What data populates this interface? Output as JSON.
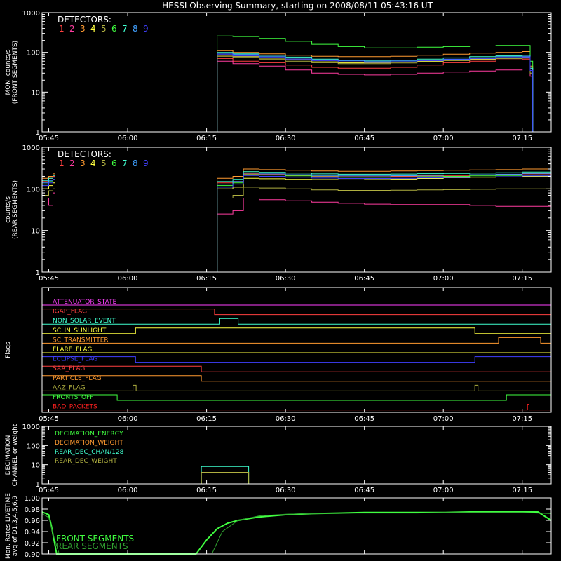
{
  "title": "HESSI Observing Summary, starting on 2008/08/11 05:43:16 UT",
  "time_ticks": [
    "05:45",
    "06:00",
    "06:15",
    "06:30",
    "06:45",
    "07:00",
    "07:15"
  ],
  "chart_data": [
    {
      "type": "line",
      "panel": "front-counts",
      "ylabel": [
        "MON. counts/s",
        "(FRONT SEGMENTS)"
      ],
      "yscale": "log",
      "ylim": [
        1,
        1000
      ],
      "ytick_labels": [
        "1",
        "10",
        "100",
        "1000"
      ],
      "xlim_min": [
        -1.27,
        95.5
      ],
      "detectors_label": "DETECTORS:",
      "detector_numbers": [
        "1",
        "2",
        "3",
        "4",
        "5",
        "6",
        "7",
        "8",
        "9"
      ],
      "detector_colors": [
        "#ff4040",
        "#ff3ca0",
        "#ff9a30",
        "#ffff40",
        "#b0b040",
        "#40ff40",
        "#40ffd0",
        "#40a0ff",
        "#4040ff"
      ],
      "x": [
        31.5,
        32,
        35,
        40,
        45,
        50,
        55,
        60,
        65,
        70,
        75,
        80,
        85,
        90,
        91.5,
        92
      ],
      "series": [
        {
          "values": [
            1,
            70,
            60,
            55,
            48,
            42,
            40,
            40,
            42,
            48,
            55,
            60,
            65,
            68,
            40,
            1
          ]
        },
        {
          "values": [
            1,
            60,
            52,
            45,
            36,
            30,
            28,
            27,
            28,
            30,
            32,
            34,
            36,
            38,
            25,
            1
          ]
        },
        {
          "values": [
            1,
            110,
            100,
            92,
            85,
            80,
            78,
            78,
            80,
            85,
            90,
            96,
            100,
            105,
            45,
            1
          ]
        },
        {
          "values": [
            1,
            85,
            80,
            72,
            65,
            58,
            55,
            55,
            57,
            60,
            64,
            68,
            72,
            75,
            35,
            1
          ]
        },
        {
          "values": [
            1,
            80,
            75,
            68,
            60,
            55,
            52,
            52,
            54,
            58,
            62,
            66,
            70,
            72,
            30,
            1
          ]
        },
        {
          "values": [
            1,
            260,
            250,
            225,
            190,
            160,
            140,
            130,
            130,
            135,
            140,
            145,
            150,
            150,
            60,
            1
          ]
        },
        {
          "values": [
            1,
            100,
            92,
            85,
            76,
            68,
            64,
            63,
            64,
            68,
            73,
            78,
            82,
            85,
            40,
            1
          ]
        },
        {
          "values": [
            1,
            95,
            88,
            80,
            72,
            65,
            62,
            60,
            61,
            64,
            68,
            73,
            78,
            80,
            38,
            1
          ]
        },
        {
          "values": [
            1,
            90,
            82,
            75,
            68,
            62,
            58,
            56,
            58,
            62,
            66,
            70,
            74,
            76,
            35,
            1
          ]
        }
      ]
    },
    {
      "type": "line",
      "panel": "rear-counts",
      "ylabel": [
        "counts/s",
        "(REAR SEGMENTS)"
      ],
      "yscale": "log",
      "ylim": [
        1,
        1000
      ],
      "ytick_labels": [
        "1",
        "10",
        "100",
        "1000"
      ],
      "detectors_label": "DETECTORS:",
      "detector_numbers": [
        "1",
        "2",
        "3",
        "4",
        "5",
        "6",
        "7",
        "8",
        "9"
      ],
      "detector_colors": [
        "#ff4040",
        "#ff3ca0",
        "#ff9a30",
        "#ffff40",
        "#b0b040",
        "#40ff40",
        "#40ffd0",
        "#40a0ff",
        "#4040ff"
      ],
      "x": [
        -1.27,
        0,
        0.8,
        1.2,
        1.5,
        31.5,
        32,
        35,
        37,
        40,
        45,
        50,
        55,
        60,
        65,
        70,
        75,
        80,
        85,
        90,
        95.5
      ],
      "series": [
        {
          "values": [
            150,
            180,
            200,
            1,
            1,
            1,
            140,
            150,
            230,
            220,
            210,
            200,
            195,
            195,
            200,
            205,
            210,
            215,
            220,
            230,
            240
          ]
        },
        {
          "values": [
            60,
            40,
            80,
            1,
            1,
            1,
            25,
            30,
            60,
            55,
            52,
            48,
            45,
            43,
            42,
            42,
            42,
            40,
            38,
            38,
            40
          ]
        },
        {
          "values": [
            180,
            200,
            230,
            1,
            1,
            1,
            180,
            200,
            300,
            290,
            280,
            270,
            265,
            265,
            270,
            275,
            280,
            285,
            290,
            300,
            320
          ]
        },
        {
          "values": [
            100,
            120,
            140,
            1,
            1,
            1,
            100,
            110,
            180,
            175,
            170,
            168,
            165,
            168,
            172,
            178,
            185,
            190,
            195,
            200,
            210
          ]
        },
        {
          "values": [
            70,
            90,
            100,
            1,
            1,
            1,
            60,
            70,
            110,
            105,
            100,
            95,
            92,
            92,
            93,
            95,
            96,
            98,
            100,
            100,
            105
          ]
        },
        {
          "values": [
            130,
            150,
            170,
            1,
            1,
            1,
            120,
            140,
            220,
            215,
            205,
            195,
            190,
            190,
            193,
            197,
            200,
            205,
            210,
            215,
            225
          ]
        },
        {
          "values": [
            160,
            180,
            210,
            1,
            1,
            1,
            150,
            170,
            260,
            250,
            240,
            230,
            225,
            225,
            228,
            232,
            236,
            240,
            245,
            255,
            270
          ]
        },
        {
          "values": [
            140,
            160,
            190,
            1,
            1,
            1,
            130,
            150,
            240,
            230,
            220,
            210,
            205,
            205,
            208,
            212,
            216,
            220,
            225,
            235,
            250
          ]
        },
        {
          "values": [
            120,
            140,
            170,
            1,
            1,
            1,
            110,
            130,
            210,
            200,
            190,
            182,
            178,
            178,
            180,
            184,
            188,
            192,
            196,
            205,
            215
          ]
        }
      ]
    },
    {
      "type": "line",
      "panel": "flags",
      "ylabel": [
        "Flags"
      ],
      "flags": [
        {
          "name": "ATTENUATOR_STATE",
          "color": "#ff40ff",
          "steps": [
            [
              -1.27,
              0
            ],
            [
              95.5,
              0
            ]
          ]
        },
        {
          "name": "IGAP_FLAG",
          "color": "#ff4040",
          "steps": [
            [
              -1.27,
              1
            ],
            [
              31.5,
              0
            ],
            [
              95.5,
              0
            ]
          ]
        },
        {
          "name": "NON_SOLAR_EVENT",
          "color": "#40ffd0",
          "steps": [
            [
              -1.27,
              0
            ],
            [
              32.5,
              1
            ],
            [
              36,
              0
            ],
            [
              95.5,
              0
            ]
          ]
        },
        {
          "name": "SC_IN_SUNLIGHT",
          "color": "#ffff40",
          "steps": [
            [
              -1.27,
              0
            ],
            [
              16.5,
              1
            ],
            [
              81,
              0
            ],
            [
              95.5,
              0
            ]
          ]
        },
        {
          "name": "SC_TRANSMITTER",
          "color": "#ff9a30",
          "steps": [
            [
              -1.27,
              0
            ],
            [
              85.5,
              1
            ],
            [
              93.5,
              0
            ],
            [
              95.5,
              0
            ]
          ]
        },
        {
          "name": "FLARE_FLAG",
          "color": "#ffff40",
          "steps": [
            [
              -1.27,
              0
            ],
            [
              95.5,
              0
            ]
          ]
        },
        {
          "name": "ECLIPSE_FLAG",
          "color": "#4040ff",
          "steps": [
            [
              -1.27,
              1
            ],
            [
              16.5,
              0
            ],
            [
              81,
              1
            ],
            [
              95.5,
              1
            ]
          ]
        },
        {
          "name": "SAA_FLAG",
          "color": "#ff4040",
          "steps": [
            [
              -1.27,
              1
            ],
            [
              29,
              0
            ],
            [
              95.5,
              0
            ]
          ]
        },
        {
          "name": "PARTICLE_FLAG",
          "color": "#ff9a30",
          "steps": [
            [
              -1.27,
              1
            ],
            [
              29,
              0
            ],
            [
              95.5,
              0
            ]
          ]
        },
        {
          "name": "AAZ_FLAG",
          "color": "#b0b040",
          "steps": [
            [
              -1.27,
              0
            ],
            [
              16,
              1
            ],
            [
              16.6,
              0
            ],
            [
              81,
              1
            ],
            [
              81.6,
              0
            ],
            [
              95.5,
              0
            ]
          ]
        },
        {
          "name": "FRONTS_OFF",
          "color": "#40ff40",
          "steps": [
            [
              -1.27,
              1
            ],
            [
              13,
              0
            ],
            [
              87,
              1
            ],
            [
              95.5,
              1
            ]
          ]
        },
        {
          "name": "BAD_PACKETS",
          "color": "#ff2020",
          "steps": [
            [
              -1.27,
              0
            ],
            [
              91,
              1
            ],
            [
              91.3,
              0
            ],
            [
              95.5,
              0
            ]
          ]
        }
      ]
    },
    {
      "type": "line",
      "panel": "decimation",
      "ylabel": [
        "DECIMATION",
        "CHANNEL or weight"
      ],
      "yscale": "log",
      "ylim": [
        1,
        1000
      ],
      "ytick_labels": [
        "1",
        "10",
        "100",
        "1000"
      ],
      "series": [
        {
          "name": "DECIMATION_ENERGY",
          "color": "#40ff40",
          "x": [
            -1.27,
            95.5
          ],
          "values": [
            1,
            1
          ]
        },
        {
          "name": "DECIMATION_WEIGHT",
          "color": "#ff9a30",
          "x": [
            -1.27,
            29,
            29,
            38,
            38,
            95.5
          ],
          "values": [
            1,
            1,
            4,
            4,
            1,
            1
          ]
        },
        {
          "name": "REAR_DEC_CHAN/128",
          "color": "#40ffd0",
          "x": [
            -1.27,
            29,
            29,
            38,
            38,
            95.5
          ],
          "values": [
            1,
            1,
            8,
            8,
            1,
            1
          ]
        },
        {
          "name": "REAR_DEC_WEIGHT",
          "color": "#b0b040",
          "x": [
            -1.27,
            29,
            29,
            38,
            38,
            95.5
          ],
          "values": [
            1,
            1,
            4,
            4,
            1,
            1
          ]
        }
      ]
    },
    {
      "type": "line",
      "panel": "livetime",
      "ylabel": [
        "Mon. Rates LIVETIME",
        "avg of D1,3,4,5,6,9"
      ],
      "ylim": [
        0.9,
        1.0
      ],
      "ytick_labels": [
        "0.90",
        "0.92",
        "0.94",
        "0.96",
        "0.98",
        "1.00"
      ],
      "series": [
        {
          "name": "FRONT SEGMENTS",
          "color": "#40ff40",
          "x": [
            -1.27,
            0,
            0.5,
            1.5,
            28,
            30,
            32,
            34,
            36,
            40,
            45,
            50,
            55,
            60,
            65,
            70,
            75,
            80,
            85,
            90,
            93,
            95.5
          ],
          "values": [
            0.975,
            0.97,
            0.95,
            0.9,
            0.9,
            0.925,
            0.945,
            0.955,
            0.96,
            0.966,
            0.97,
            0.972,
            0.973,
            0.974,
            0.974,
            0.974,
            0.974,
            0.975,
            0.975,
            0.975,
            0.975,
            0.96
          ]
        },
        {
          "name": "REAR SEGMENTS",
          "color": "#30a030",
          "x": [
            -1.27,
            0,
            1,
            2,
            31,
            33,
            36,
            40,
            45,
            50,
            55,
            60,
            65,
            70,
            75,
            80,
            85,
            90,
            95.5
          ],
          "values": [
            0.972,
            0.965,
            0.93,
            0.9,
            0.9,
            0.94,
            0.96,
            0.968,
            0.971,
            0.972,
            0.973,
            0.973,
            0.973,
            0.973,
            0.974,
            0.974,
            0.974,
            0.974,
            0.972
          ]
        }
      ]
    }
  ]
}
